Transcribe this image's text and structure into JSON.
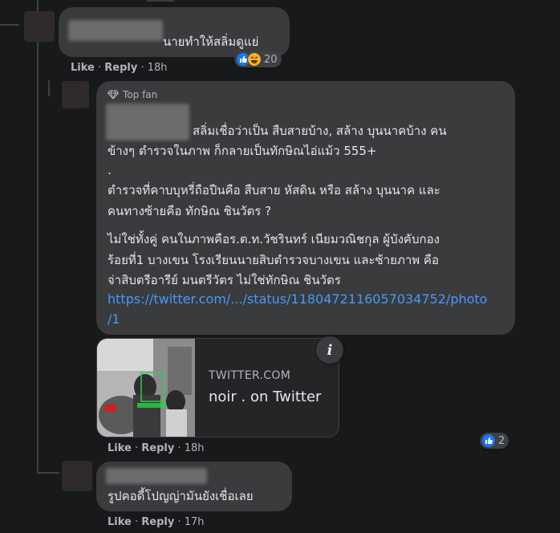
{
  "comment1": {
    "text": "นายทำให้สลิ่มดูแย่",
    "actions": {
      "like": "Like",
      "sep": " · ",
      "reply": "Reply",
      "time": "18h"
    },
    "reactions": {
      "icons": [
        "like-icon",
        "haha-icon"
      ],
      "count": "20"
    }
  },
  "comment2": {
    "badge_label": "Top fan",
    "lines": [
      "สลิ่มเชื่อว่าเป็น สืบสายบ้าง, สล้าง บุนนาคบ้าง คน",
      "ข้างๆ ตำรวจในภาพ ก็กลายเป็นทักษิณไอ่แม้ว 555+",
      ".",
      "ตำรวจที่คาบบุหรี่ถือปืนคือ สืบสาย หัสดิน หรือ สล้าง บุนนาค และ",
      "คนทางซ้ายคือ ทักษิณ ชินวัตร ?",
      "ไม่ใช่ทั้งคู่ คนในภาพคือร.ต.ท.วัชรินทร์ เนียมวณิชกุล ผู้บังคับกอง",
      "ร้อยที่1 บางเขน โรงเรียนนายสิบตำรวจบางเขน และซ้ายภาพ คือ",
      "จ่าสิบตรีอารีย์ มนตรีวัตร ไม่ใช่ทักษิณ ชินวัตร"
    ],
    "link_line1": "https://twitter.com/.../status/1180472116057034752/photo",
    "link_line2": "/1",
    "card": {
      "domain": "TWITTER.COM",
      "title": "noir . on Twitter",
      "info_glyph": "i"
    },
    "actions": {
      "like": "Like",
      "sep": " · ",
      "reply": "Reply",
      "time": "18h"
    },
    "reactions": {
      "icons": [
        "like-icon"
      ],
      "count": "2"
    }
  },
  "comment3": {
    "text": "รูปคอดี้โปญญ่ามันยังเชื่อเลย",
    "actions": {
      "like": "Like",
      "sep": " · ",
      "reply": "Reply",
      "time": "17h"
    }
  }
}
